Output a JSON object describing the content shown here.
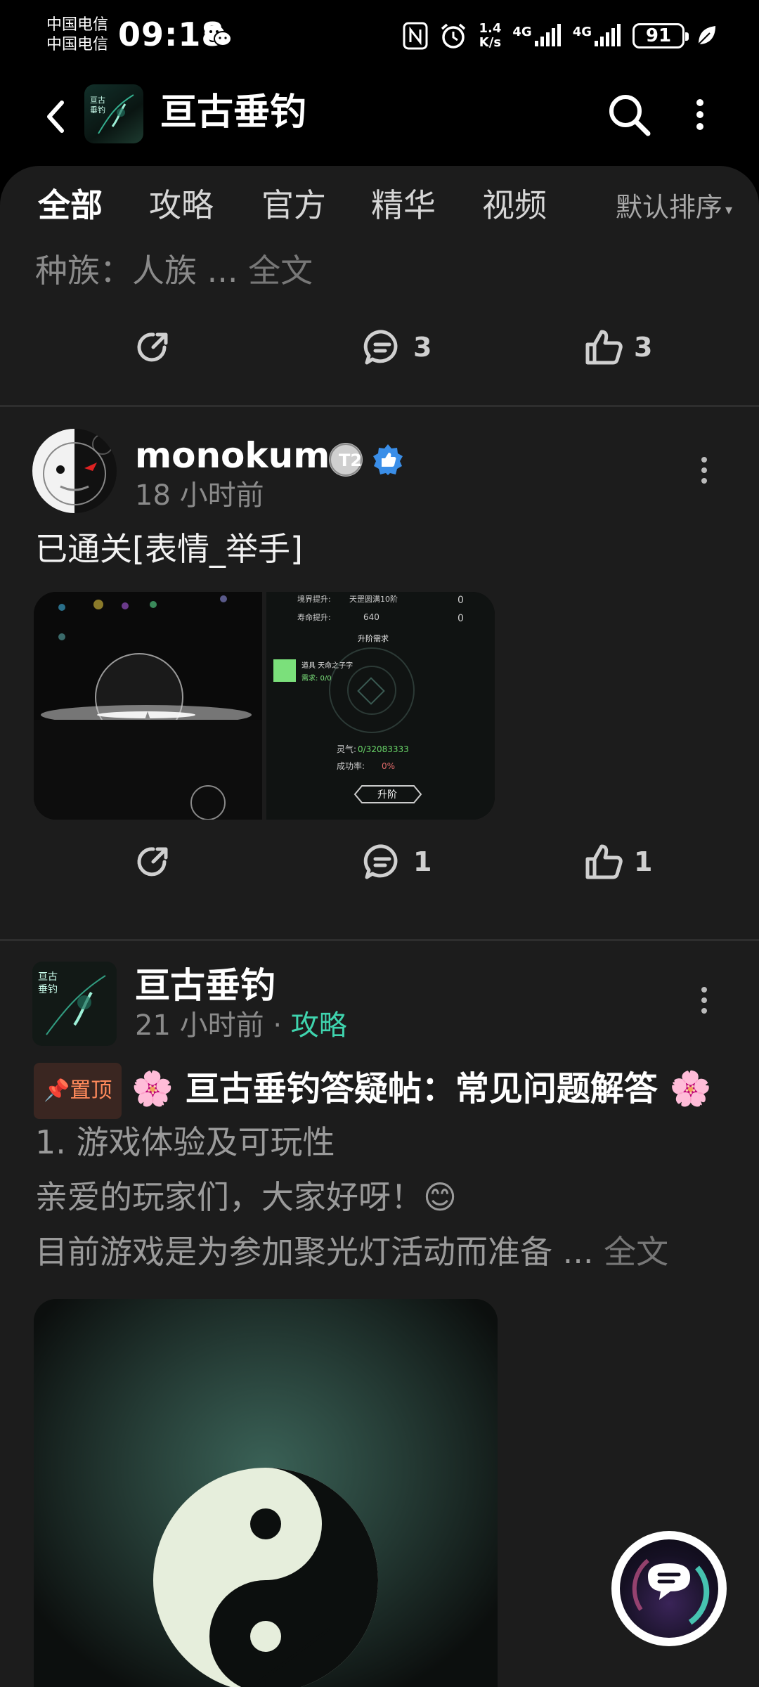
{
  "status_bar": {
    "carrier_1": "中国电信",
    "carrier_2": "中国电信",
    "time": "09:18",
    "net_speed_value": "1.4",
    "net_speed_unit": "K/s",
    "sim1_type": "4G",
    "sim2_type": "4G",
    "battery": "91",
    "icons": [
      "wechat-icon",
      "nfc-icon",
      "alarm-icon",
      "signal-icon",
      "battery-icon",
      "leaf-icon"
    ]
  },
  "header": {
    "forum_logo_text": "亘古垂钓",
    "title": "亘古垂钓",
    "icons": [
      "back-icon",
      "search-icon",
      "more-vertical-icon"
    ]
  },
  "tabs": {
    "items": [
      {
        "label": "全部",
        "active": true
      },
      {
        "label": "攻略",
        "active": false
      },
      {
        "label": "官方",
        "active": false
      },
      {
        "label": "精华",
        "active": false
      },
      {
        "label": "视频",
        "active": false
      }
    ],
    "sort_label": "默认排序",
    "sort_caret": "▾"
  },
  "post0": {
    "snippet": "种族：人族 ...",
    "full_text": "全文",
    "comments": "3",
    "likes": "3"
  },
  "post1": {
    "username": "monokuma",
    "time": "18 小时前",
    "level_badge": "T2",
    "text": "已通关[表情_举手]",
    "image2_labels": {
      "realm_up": "境界提升:",
      "realm_value": "天罡圆满10阶",
      "life_up": "寿命提升:",
      "life_value": "640",
      "zero_a": "0",
      "zero_b": "0",
      "ascend_req": "升阶需求",
      "item_req": "道具 天命之子字",
      "need": "需求: 0/0",
      "qi": "灵气:",
      "qi_value": "0/32083333",
      "rate": "成功率:",
      "rate_value": "0%",
      "ascend_btn": "升阶"
    },
    "comments": "1",
    "likes": "1"
  },
  "post2": {
    "username": "亘古垂钓",
    "time": "21 小时前",
    "separator": "·",
    "tag": "攻略",
    "pin_label": "置顶",
    "flower": "🌸",
    "title": "亘古垂钓答疑帖：常见问题解答",
    "line1": "1. 游戏体验及可玩性",
    "line2": "亲爱的玩家们，大家好呀！",
    "line2_emoji": "😊",
    "line3": "目前游戏是为参加聚光灯活动而准备 ...",
    "full_text": "全文"
  },
  "colors": {
    "accent": "#3fd4ae",
    "panel_bg": "#1c1c1c",
    "pin_text": "#ff8a5b"
  }
}
